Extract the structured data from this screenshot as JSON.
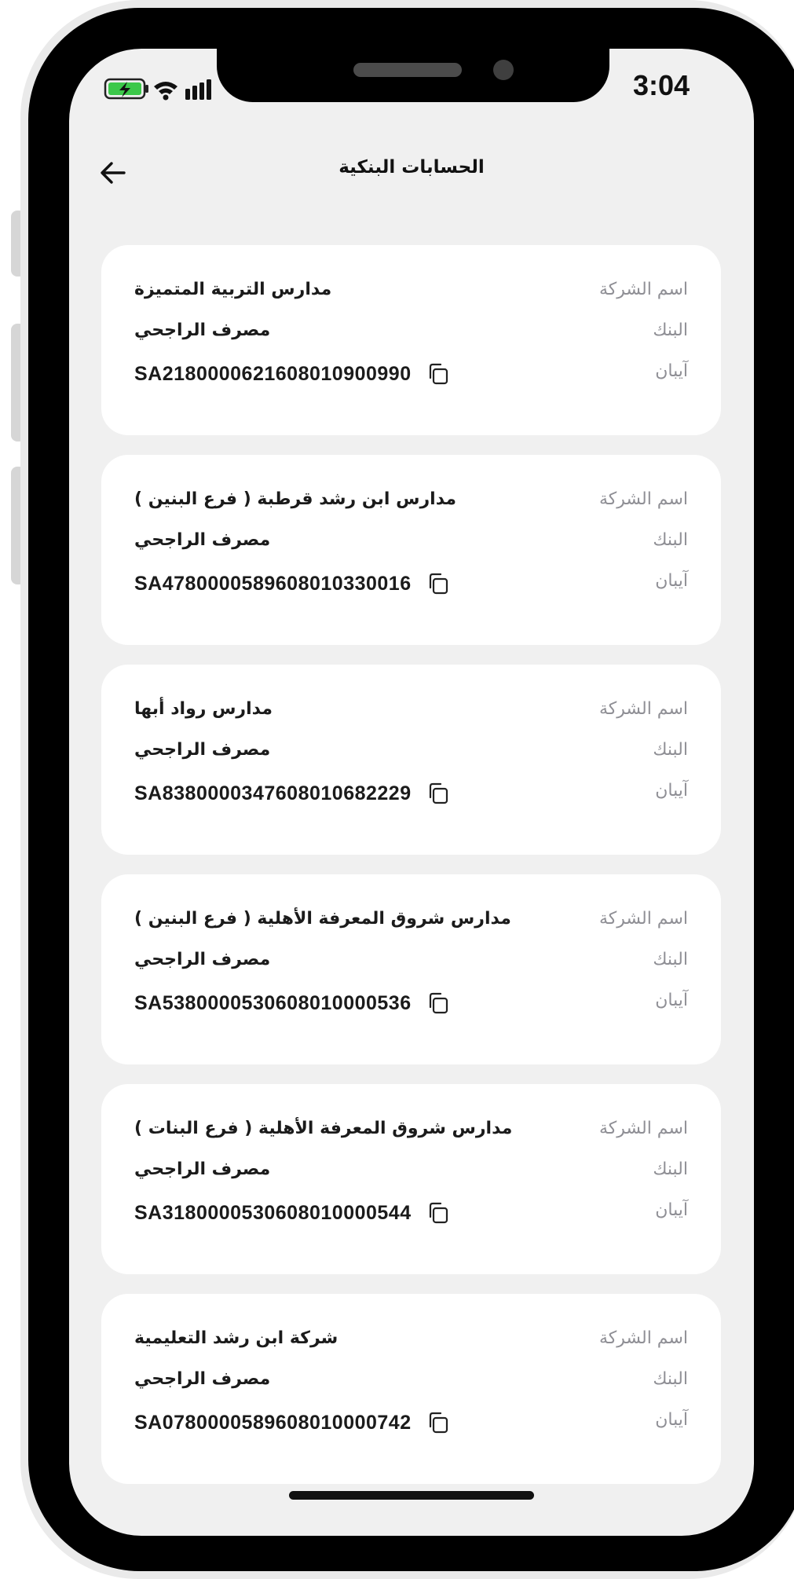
{
  "status_bar": {
    "time": "3:04"
  },
  "header": {
    "title": "الحسابات البنكية",
    "back_icon": "arrow-left-icon"
  },
  "labels": {
    "company": "اسم الشركة",
    "bank": "البنك",
    "iban": "آيبان"
  },
  "accounts": [
    {
      "company": "مدارس التربية المتميزة",
      "bank": "مصرف الراجحي",
      "iban": "SA2180000621608010900990"
    },
    {
      "company": "مدارس ابن رشد قرطبة ( فرع البنين )",
      "bank": "مصرف الراجحي",
      "iban": "SA4780000589608010330016"
    },
    {
      "company": "مدارس رواد أبها",
      "bank": "مصرف الراجحي",
      "iban": "SA8380000347608010682229"
    },
    {
      "company": "مدارس شروق المعرفة الأهلية ( فرع البنين )",
      "bank": "مصرف الراجحي",
      "iban": "SA5380000530608010000536"
    },
    {
      "company": "مدارس شروق المعرفة الأهلية ( فرع البنات )",
      "bank": "مصرف الراجحي",
      "iban": "SA3180000530608010000544"
    },
    {
      "company": "شركة ابن رشد التعليمية",
      "bank": "مصرف الراجحي",
      "iban": "SA0780000589608010000742"
    }
  ],
  "colors": {
    "screen_bg": "#f0f0f0",
    "card_bg": "#ffffff",
    "label": "#8f8f95",
    "value": "#1b1b1b",
    "battery": "#3cc84a"
  }
}
